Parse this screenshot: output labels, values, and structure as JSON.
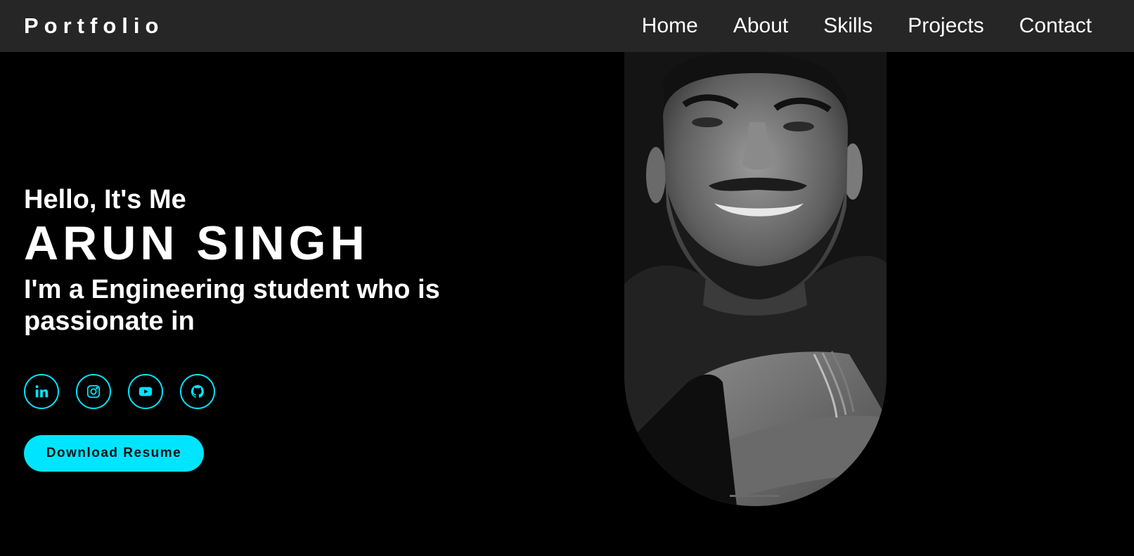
{
  "nav": {
    "logo": "Portfolio",
    "links": [
      "Home",
      "About",
      "Skills",
      "Projects",
      "Contact"
    ]
  },
  "hero": {
    "greeting": "Hello, It's Me",
    "name": "ARUN SINGH",
    "tagline": "I'm a Engineering student who is passionate in"
  },
  "socials": [
    {
      "icon": "linkedin-icon"
    },
    {
      "icon": "instagram-icon"
    },
    {
      "icon": "youtube-icon"
    },
    {
      "icon": "github-icon"
    }
  ],
  "resume_button": "Download Resume",
  "colors": {
    "accent": "#00e5ff",
    "navbar_bg": "#262626",
    "page_bg": "#000000"
  }
}
